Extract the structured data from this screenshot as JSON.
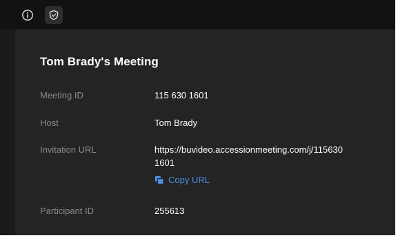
{
  "toolbar": {
    "info_icon": "info-icon",
    "shield_icon": "shield-check-icon"
  },
  "meeting": {
    "title": "Tom Brady's Meeting",
    "fields": {
      "meeting_id": {
        "label": "Meeting ID",
        "value": "115 630 1601"
      },
      "host": {
        "label": "Host",
        "value": "Tom Brady"
      },
      "invitation_url": {
        "label": "Invitation URL",
        "value": "https://buvideo.accessionmeeting.com/j/115630\n1601"
      },
      "participant_id": {
        "label": "Participant ID",
        "value": "255613"
      }
    },
    "copy_url_label": "Copy URL"
  },
  "colors": {
    "background": "#1a1a1a",
    "card": "#242424",
    "label": "#8b8b8b",
    "link": "#4a90e2"
  }
}
